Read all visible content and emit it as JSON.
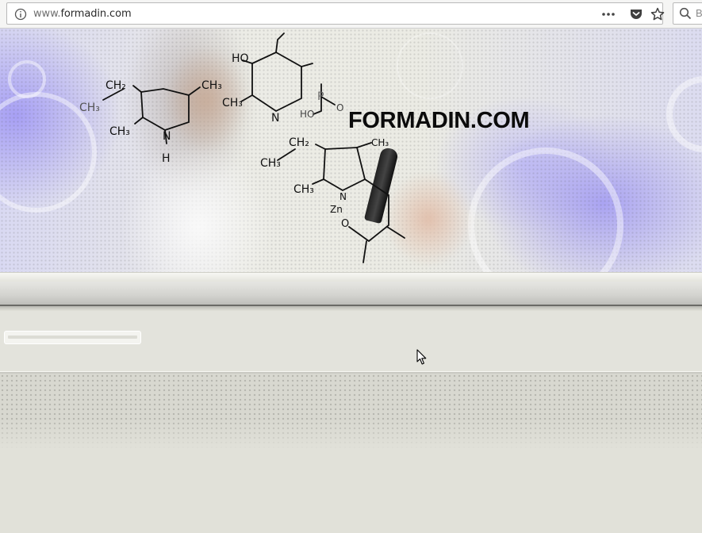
{
  "browser": {
    "url_host": "www.formadin.com",
    "url_prefix": "www.",
    "url_domain": "formadin.com",
    "search_peek": "B"
  },
  "banner": {
    "title": "FORMADIN.COM",
    "chem_labels": {
      "ch2_left": "CH₂",
      "ch3_left_a": "CH₃",
      "ch3_left_b": "CH₃",
      "ch3_left_c": "CH₃",
      "nh_n": "N",
      "nh_h": "H",
      "ho_top": "HO",
      "ch3_mid": "CH₃",
      "n_mid": "N",
      "p_label": "P",
      "ho_p": "HO",
      "o_p": "O",
      "ch2_lower": "CH₂",
      "ch3_lower_a": "CH₃",
      "ch3_lower_b": "CH₃",
      "ch3_lower_c": "CH₃",
      "zn_label": "Zn",
      "n_lower": "N",
      "o_lower": "O"
    }
  },
  "icons": {
    "info": "info-icon",
    "menu": "more-icon",
    "pocket": "pocket-icon",
    "bookmark": "star-icon",
    "search": "search-icon",
    "cursor": "cursor-icon"
  },
  "colors": {
    "page_bg": "#e1e1d9",
    "banner_accent": "#9d96f2",
    "title": "#0b0b0b"
  }
}
